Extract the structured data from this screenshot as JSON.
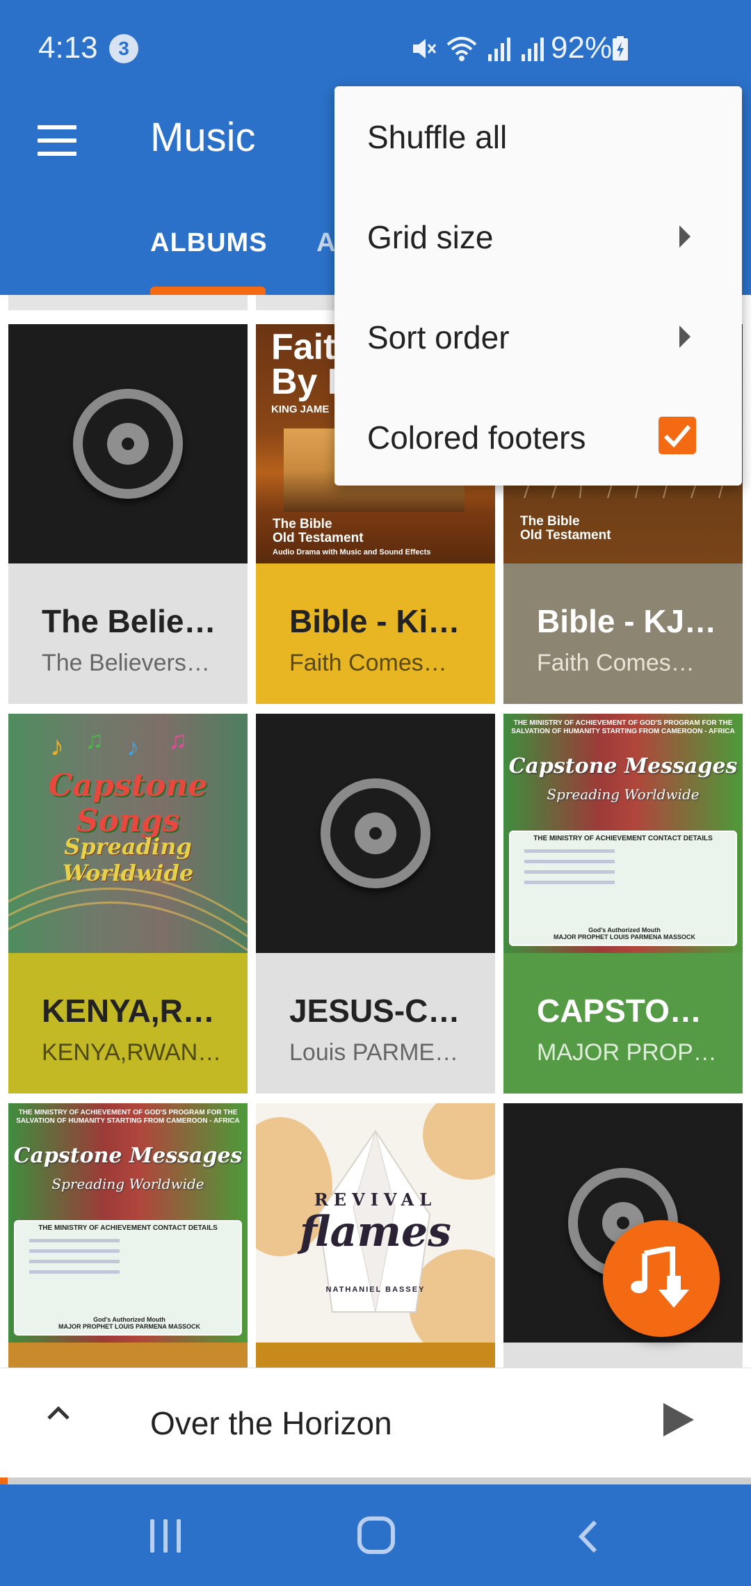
{
  "status_bar": {
    "time": "4:13",
    "notification_count": "3",
    "battery_percent": "92%",
    "icons": [
      "mute-icon",
      "wifi-icon",
      "signal-icon",
      "signal-icon",
      "battery-charging-icon"
    ]
  },
  "app_bar": {
    "title": "Music",
    "tabs": [
      {
        "label": "ALBUMS",
        "selected": true
      },
      {
        "label": "A",
        "selected": false
      }
    ]
  },
  "menu": {
    "items": [
      {
        "label": "Shuffle all"
      },
      {
        "label": "Grid size",
        "has_submenu": true
      },
      {
        "label": "Sort order",
        "has_submenu": true
      },
      {
        "label": "Colored footers",
        "checked": true
      }
    ]
  },
  "albums": [
    {
      "title": "The Belie…",
      "subtitle": "The Believers…",
      "art": "disc-placeholder",
      "footer_color": "#e0e0e0"
    },
    {
      "title": "Bible - Ki…",
      "subtitle": "Faith Comes…",
      "art": "bible-cover",
      "footer_color": "#e7b622",
      "art_text": {
        "head_line1": "Fait",
        "head_line2": "By I",
        "sub": "KING JAME",
        "old": "The Bible",
        "old2": "Old Testament",
        "small": "Audio Drama with Music and Sound Effects"
      }
    },
    {
      "title": "Bible - KJ…",
      "subtitle": "Faith Comes…",
      "art": "bible-cover-2",
      "footer_color": "#8c8571",
      "art_text": {
        "old": "The Bible",
        "old2": "Old Testament"
      }
    },
    {
      "title": "KENYA,R…",
      "subtitle": "KENYA,RWAN…",
      "art": "capstone-songs",
      "footer_color": "#c3b924",
      "art_text": {
        "line1": "Capstone Songs",
        "line2": "Spreading Worldwide"
      }
    },
    {
      "title": "JESUS-C…",
      "subtitle": "Louis PARME…",
      "art": "disc-placeholder",
      "footer_color": "#e0e0e0"
    },
    {
      "title": "CAPSTO…",
      "subtitle": "MAJOR PROP…",
      "art": "capstone-messages",
      "footer_color": "#559a45"
    },
    {
      "title": "",
      "subtitle": "",
      "art": "capstone-messages",
      "footer_color": "#c98a2c"
    },
    {
      "title": "",
      "subtitle": "",
      "art": "revival-flames",
      "footer_color": "#c98a1c",
      "art_text": {
        "line1": "REVIVAL",
        "line2": "flames",
        "artist": "NATHANIEL BASSEY"
      }
    },
    {
      "title": "",
      "subtitle": "",
      "art": "disc-placeholder",
      "footer_color": "#e0e0e0"
    }
  ],
  "capstone_messages_art": {
    "top": "THE MINISTRY OF ACHIEVEMENT OF GOD'S PROGRAM FOR THE SALVATION OF HUMANITY STARTING FROM CAMEROON - AFRICA",
    "title": "Capstone Messages",
    "subtitle": "Spreading Worldwide",
    "box_title": "THE MINISTRY OF ACHIEVEMENT CONTACT DETAILS",
    "footer1": "God's Authorized Mouth",
    "footer2": "MAJOR PROPHET LOUIS PARMENA MASSOCK"
  },
  "now_playing": {
    "title": "Over the Horizon",
    "progress": 0.01
  },
  "colors": {
    "primary": "#2b71c9",
    "accent": "#f46a12"
  }
}
